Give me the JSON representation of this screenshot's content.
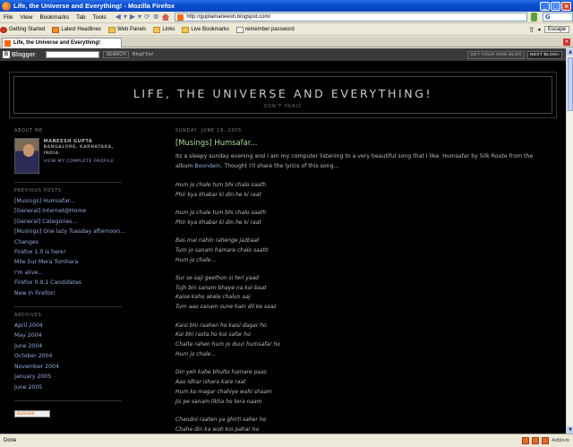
{
  "window": {
    "title": "Life, the Universe and Everything! - Mozilla Firefox"
  },
  "menubar": {
    "items": [
      "File",
      "View",
      "Bookmarks",
      "Tab",
      "Tools"
    ],
    "url": "http://guptamaneesh.blogspot.com/"
  },
  "bookmarks": {
    "items": [
      "Getting Started",
      "Latest Headlines",
      "Web Panels",
      "Links",
      "Live Bookmarks",
      "remember password"
    ],
    "escape_label": "Escape"
  },
  "tab": {
    "label": "Life, the Universe and Everything!"
  },
  "blogger_nav": {
    "logo": "Blogger",
    "search_label": "SEARCH",
    "blogthis_label": "BlogThis!",
    "get_own_blog": "GET YOUR OWN BLOG",
    "next_blog": "NEXT BLOG»"
  },
  "header": {
    "title": "LIFE, THE UNIVERSE AND EVERYTHING!",
    "description": "DON'T PANIC"
  },
  "sidebar": {
    "about_heading": "ABOUT ME",
    "profile_name": "MANEESH GUPTA",
    "profile_location": "BANGALORE, KARNATAKA, INDIA",
    "profile_link": "VIEW MY COMPLETE PROFILE",
    "previous_heading": "PREVIOUS POSTS",
    "previous_posts": [
      "[Musings] Humsafar...",
      "[General] Internet@Home",
      "[General] Categories...",
      "[Musings] One lazy Tuesday afternoon...",
      "Changes",
      "Firefox 1.0 is here!",
      "Mile Sur Mera Tumhara",
      "I'm alive...",
      "Firefox 0.9.1 Candidates",
      "New in Firefox!"
    ],
    "archives_heading": "ARCHIVES",
    "archives": [
      "April 2004",
      "May 2004",
      "June 2004",
      "October 2004",
      "November 2004",
      "January 2005",
      "June 2005"
    ],
    "badge": "BLOGGER"
  },
  "post": {
    "date": "SUNDAY, JUNE 19, 2005",
    "title": "[Musings] Humsafar...",
    "intro_before": "Its a sleepy sunday evening and I am my computer listening to a very beautiful song that I like. Humsafar by Silk Route from the album ",
    "intro_link": "Boondein",
    "intro_after": ". Thought I'll share the lyrics of this song...",
    "stanzas": [
      [
        "Hum jo chale tum bhi chalo saath",
        "Phir kya khabar ki din he ki raat"
      ],
      [
        "Hum jo chale tum bhi chalo saath",
        "Phir kya khabar ki din he ki raat"
      ],
      [
        "Bas mai nahin rahenge jazbaat",
        "Tum jo sanam hamare chalo saath",
        "Hum jo chale..."
      ],
      [
        "Sur se saji geethon si teri yaad",
        "Tujh bin sanam bhaye na koi baat",
        "Kaise kaho akele chalun aaj",
        "Tum aao sanam sune hain dil ke saaz"
      ],
      [
        "Kaisi bhi raahen ho kaisi dagar ho",
        "Koi bhi rasta ho koi safar ho",
        "Chalte rahen hum jo duur humsafar ho",
        "Hum jo chale..."
      ],
      [
        "Din yeh kahe bhulto hamare paas",
        "Aao idhar ishara kare raat",
        "Hum ko magar chahiye wahi shaam",
        "Jis pe sanam likha ho tera naam"
      ],
      [
        "Chandni raaten ya ghirti saher ho",
        "Chahe din ka woh koi pahar ho"
      ]
    ]
  },
  "status": {
    "text": "Done",
    "adblock": "Adblock"
  }
}
